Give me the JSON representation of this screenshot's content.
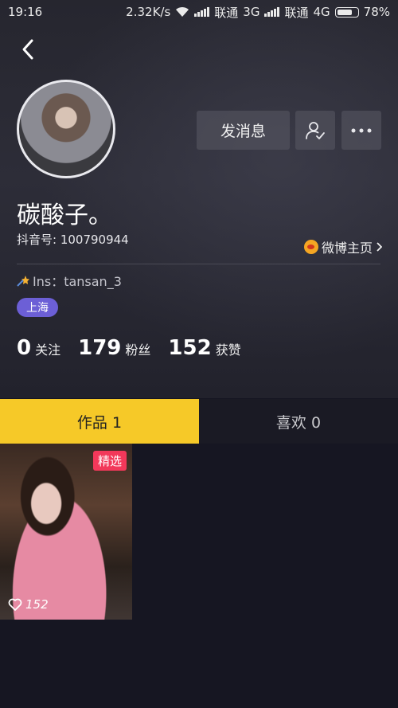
{
  "status_bar": {
    "time": "19:16",
    "net_speed": "2.32K/s",
    "carrier1": "联通",
    "net1": "3G",
    "carrier2": "联通",
    "net2": "4G",
    "battery": "78%",
    "battery_level": 0.78
  },
  "profile": {
    "name": "碳酸子。",
    "account_id": "抖音号: 100790944",
    "weibo_link": "微博主页",
    "bio": "Ins：tansan_3",
    "location": "上海",
    "message_button": "发消息"
  },
  "stats": [
    {
      "number": "0",
      "label": "关注"
    },
    {
      "number": "179",
      "label": "粉丝"
    },
    {
      "number": "152",
      "label": "获赞"
    }
  ],
  "tabs": [
    {
      "label": "作品 1",
      "active": true
    },
    {
      "label": "喜欢 0",
      "active": false
    }
  ],
  "videos": [
    {
      "badge": "精选",
      "likes": "152"
    }
  ],
  "colors": {
    "accent_yellow": "#f6c928",
    "badge_red": "#f2385a",
    "location_purple": "#6c5fd6",
    "background": "#161622"
  },
  "icons": [
    "back-icon",
    "follow-user-icon",
    "more-icon",
    "weibo-icon",
    "star-icon",
    "heart-icon",
    "wifi-icon",
    "signal-icon",
    "battery-icon"
  ]
}
